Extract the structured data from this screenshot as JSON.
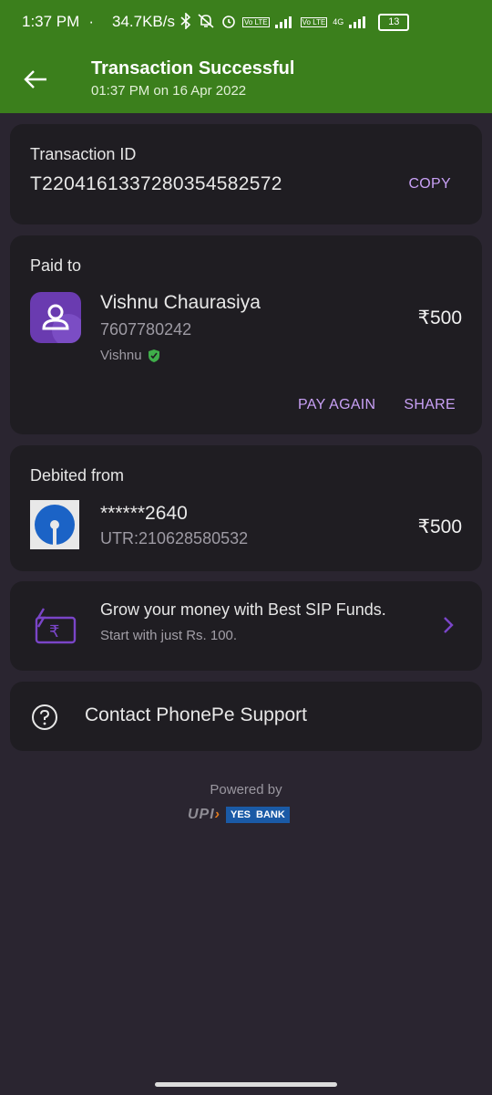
{
  "status_bar": {
    "time": "1:37 PM",
    "dot": "·",
    "speed": "34.7KB/s",
    "net1": "Vo LTE",
    "net2": "4G",
    "battery": "13"
  },
  "header": {
    "title": "Transaction Successful",
    "subtitle": "01:37 PM on 16 Apr 2022"
  },
  "transaction": {
    "label": "Transaction ID",
    "id": "T2204161337280354582572",
    "copy_label": "COPY"
  },
  "paid_to": {
    "label": "Paid to",
    "name": "Vishnu Chaurasiya",
    "phone": "7607780242",
    "upi_name": "Vishnu",
    "amount": "₹500",
    "pay_again_label": "PAY AGAIN",
    "share_label": "SHARE"
  },
  "debited_from": {
    "label": "Debited from",
    "account": "******2640",
    "utr": "UTR:210628580532",
    "amount": "₹500"
  },
  "promo": {
    "title": "Grow your money with Best SIP Funds.",
    "subtitle": "Start with just Rs. 100."
  },
  "support": {
    "label": "Contact PhonePe Support"
  },
  "footer": {
    "powered_by": "Powered by",
    "upi_text": "UPI",
    "bank_yes": "YES",
    "bank_name": "BANK"
  },
  "colors": {
    "header_green": "#3b7f1c",
    "accent_purple": "#c8a0f5",
    "verified_green": "#3fae4a",
    "background": "#2a2530",
    "card": "#1f1d22"
  }
}
